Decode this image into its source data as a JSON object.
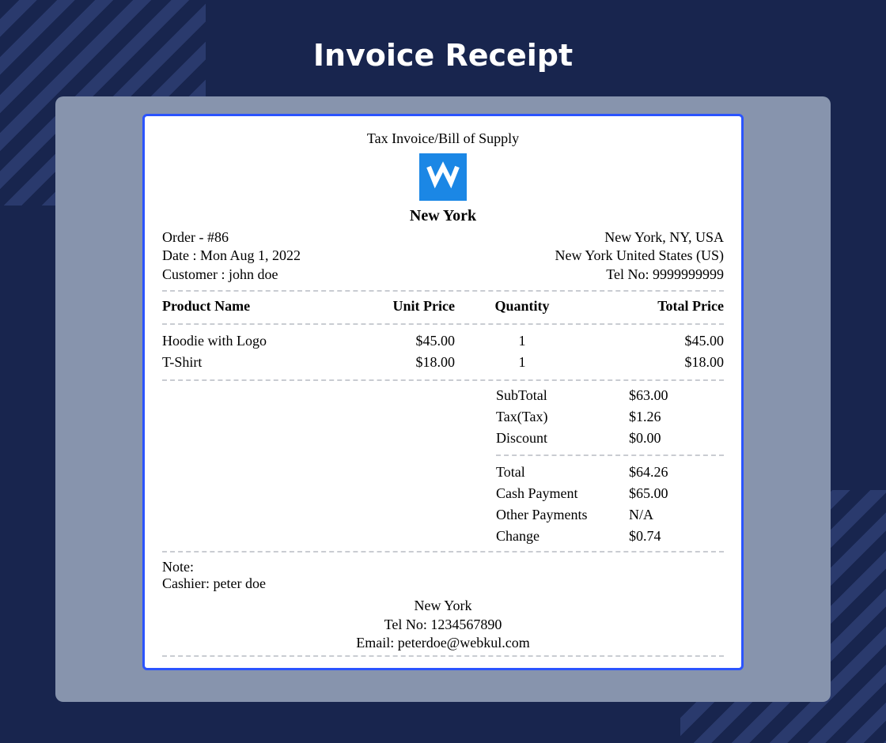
{
  "page_title": "Invoice Receipt",
  "receipt": {
    "header_line": "Tax Invoice/Bill of Supply",
    "store_name": "New York",
    "meta_left": {
      "order": "Order - #86",
      "date": "Date : Mon Aug 1, 2022",
      "customer": "Customer : john doe"
    },
    "meta_right": {
      "addr1": "New York, NY, USA",
      "addr2": "New York United States (US)",
      "tel": "Tel No: 9999999999"
    },
    "columns": {
      "product": "Product Name",
      "unit_price": "Unit Price",
      "quantity": "Quantity",
      "total_price": "Total Price"
    },
    "items": [
      {
        "name": "Hoodie with Logo",
        "unit_price": "$45.00",
        "qty": "1",
        "total": "$45.00"
      },
      {
        "name": "T-Shirt",
        "unit_price": "$18.00",
        "qty": "1",
        "total": "$18.00"
      }
    ],
    "totals_top": [
      {
        "label": "SubTotal",
        "value": "$63.00"
      },
      {
        "label": "Tax(Tax)",
        "value": "$1.26"
      },
      {
        "label": "Discount",
        "value": "$0.00"
      }
    ],
    "totals_bottom": [
      {
        "label": "Total",
        "value": "$64.26"
      },
      {
        "label": "Cash Payment",
        "value": "$65.00"
      },
      {
        "label": "Other Payments",
        "value": "N/A"
      },
      {
        "label": "Change",
        "value": "$0.74"
      }
    ],
    "note_label": "Note:",
    "cashier": "Cashier: peter doe",
    "footer": {
      "store": "New York",
      "tel": "Tel No: 1234567890",
      "email": "Email: peterdoe@webkul.com"
    }
  }
}
